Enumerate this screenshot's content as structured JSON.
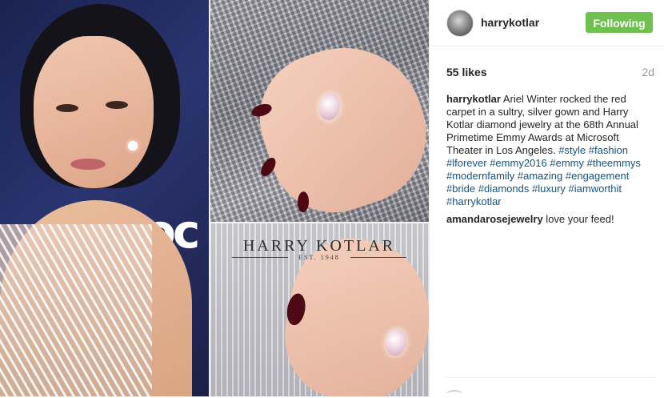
{
  "header": {
    "username": "harrykotlar",
    "follow_label": "Following"
  },
  "stats": {
    "likes": "55 likes",
    "time": "2d"
  },
  "caption": {
    "user": "harrykotlar",
    "text": " Ariel Winter rocked the red carpet in a sultry, silver gown and Harry Kotlar diamond jewelry at the 68th Annual Primetime Emmy Awards at Microsoft Theater in Los Angeles. ",
    "hashtags": [
      "#style",
      "#fashion",
      "#lforever",
      "#emmy2016",
      "#emmy",
      "#theemmys",
      "#modernfamily",
      "#amazing",
      "#engagement",
      "#bride",
      "#diamonds",
      "#luxury",
      "#iamworthit",
      "#harrykotlar"
    ]
  },
  "comments": [
    {
      "user": "amandarosejewelry",
      "text": " love your feed!"
    }
  ],
  "media": {
    "brand": "HARRY KOTLAR",
    "brand_sub": "EST. 1948",
    "logo_text": "oc"
  },
  "colors": {
    "follow_bg": "#70c050",
    "hashtag": "#125688",
    "muted": "#999999"
  }
}
